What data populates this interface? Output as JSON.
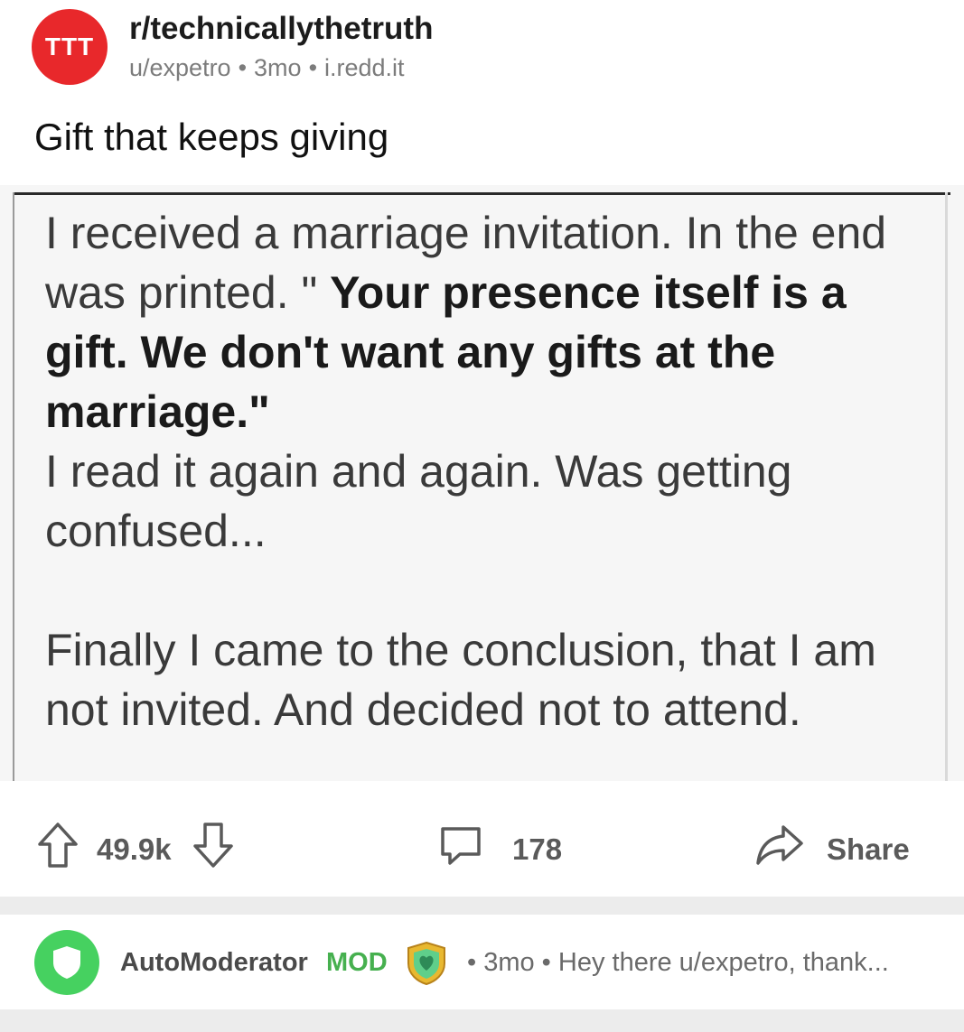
{
  "post": {
    "subreddit_avatar_text": "TTT",
    "subreddit": "r/technicallythetruth",
    "author": "u/expetro",
    "age": "3mo",
    "domain": "i.redd.it",
    "separator": "•",
    "title": "Gift that keeps giving"
  },
  "image_text": {
    "line1_normal": "I received a marriage invitation. In the end was printed. \" ",
    "line1_bold": "Your presence itself is a gift. We don't want any gifts at the marriage.\"",
    "para2": "I read it again and again. Was getting confused...",
    "para3": "Finally I came to the conclusion, that I am not invited. And decided not to attend."
  },
  "actions": {
    "score": "49.9k",
    "comments": "178",
    "share_label": "Share"
  },
  "comment": {
    "author": "AutoModerator",
    "flag": "MOD",
    "meta": "• 3mo • Hey there u/expetro, thank..."
  },
  "colors": {
    "subreddit_avatar": "#e8282b",
    "mod_green": "#46d160",
    "muted_text": "#7c7c7c"
  },
  "icons": [
    "upvote-icon",
    "downvote-icon",
    "comment-icon",
    "share-icon",
    "shield-icon",
    "mod-badge-icon"
  ]
}
